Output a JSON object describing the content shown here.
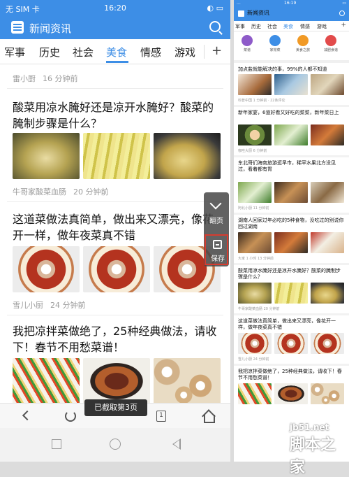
{
  "left": {
    "status": {
      "carrier": "无 SIM 卡",
      "time": "16:20",
      "battery": "◐ ▭"
    },
    "app_title": "新闻资讯",
    "categories": [
      "军事",
      "历史",
      "社会",
      "美食",
      "情感",
      "游戏"
    ],
    "active_category": "美食",
    "plus": "+",
    "top_meta": {
      "source": "雷小厨",
      "time": "16 分钟前"
    },
    "articles": [
      {
        "title": "酸菜用凉水腌好还是凉开水腌好？酸菜的腌制步骤是什么？",
        "source": "牛哥家酸菜血肠",
        "time": "20 分钟前"
      },
      {
        "title": "这道菜做法真简单，做出来又漂亮，像花开一样，做年夜菜真不错",
        "source": "雪儿小厨",
        "time": "24 分钟前"
      },
      {
        "title": "我把凉拌菜做绝了，25种经典做法，请收下！春节不用愁菜谱！"
      }
    ],
    "float": {
      "next_label": "翻页",
      "save_label": "保存"
    },
    "toast": "已截取第3页",
    "pages_badge": "1"
  },
  "right": {
    "status": {
      "left": "...",
      "time": "16:19",
      "right": "▭"
    },
    "app_title": "新闻资讯",
    "categories": [
      "军事",
      "历史",
      "社会",
      "美食",
      "情感",
      "游戏"
    ],
    "active_category": "美食",
    "quick": [
      "菜谱",
      "家常菜",
      "美食之旅",
      "减肥食谱"
    ],
    "items": [
      {
        "title": "加点盐就能解决的事，99%的人都不知道",
        "meta": "科普中国 1 分钟前 · 22条评论"
      },
      {
        "title": "新年家宴，6道好看又好吃的菜菜，新年菜日上",
        "meta": "咖哇大厨 6 分钟前"
      },
      {
        "title": "东北哥们海南旅游逛早市，稀罕水果北方没见过，看着都有胃",
        "meta": "阿北小厨 11 分钟前"
      },
      {
        "title": "湖南人回家过年必吃的5种食物，没吃过的别说你回过湖南",
        "meta": "大家 1 小时 13 分钟前"
      },
      {
        "title": "酸菜用凉水腌好还是凉开水腌好？酸菜的腌制步骤是什么？",
        "meta": "牛哥家酸菜血肠 20 分钟前"
      },
      {
        "title": "这道菜做法真简单，做出来又漂亮，像花开一样，做年夜菜真不错",
        "meta": "雪儿小厨 24 分钟前"
      },
      {
        "title": "我把凉拌菜做绝了，25种经典做法，请收下！春节不用愁菜谱！",
        "meta": ""
      }
    ]
  },
  "watermark": {
    "site": "jb51.net",
    "name": "脚本之家"
  }
}
